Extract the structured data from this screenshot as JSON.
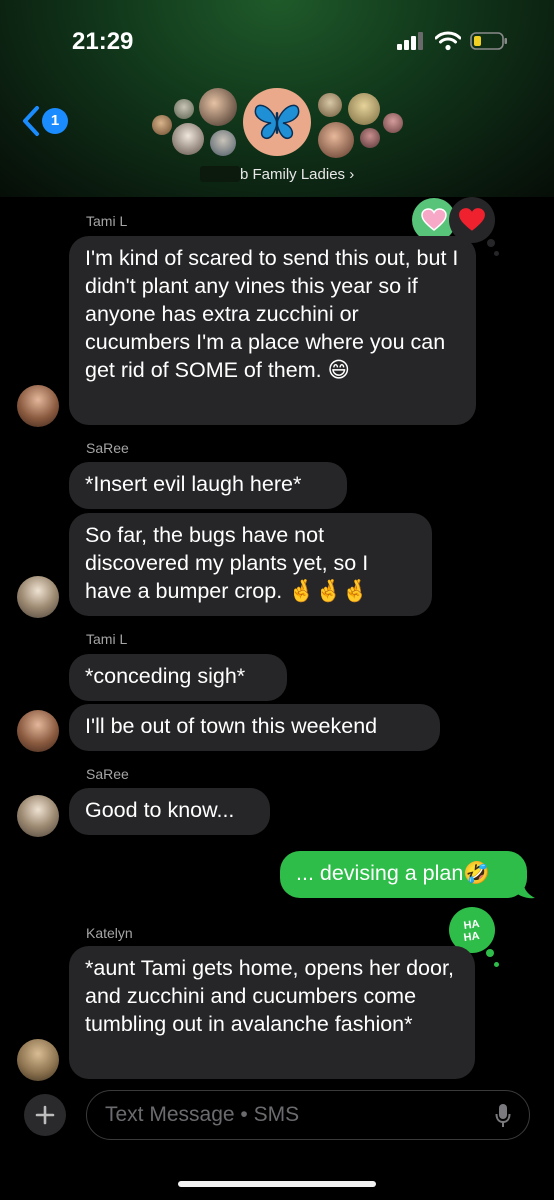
{
  "status_bar": {
    "time": "21:29"
  },
  "header": {
    "back_badge": "1",
    "group_name_suffix": "b Family Ladies ›"
  },
  "conversation": {
    "messages": [
      {
        "sender": "Tami L",
        "text": "I'm kind of scared to send this out, but I didn't plant any vines this year so if anyone has extra zucchini or cucumbers I'm a place where you can get rid of SOME of them. 😄",
        "tapbacks": [
          "heart",
          "heart"
        ]
      },
      {
        "sender": "SaRee",
        "text": "*Insert evil laugh here*"
      },
      {
        "sender": "",
        "text": "So far, the bugs have not discovered my plants yet, so I have a bumper crop. 🤞🤞🤞"
      },
      {
        "sender": "Tami L",
        "text": "*conceding sigh*"
      },
      {
        "sender": "",
        "text": "I'll be out of town this weekend"
      },
      {
        "sender": "SaRee",
        "text": "Good to know..."
      },
      {
        "sender": "me",
        "text": "... devising a plan🤣"
      },
      {
        "sender": "Katelyn",
        "text": "*aunt Tami gets home, opens her door, and zucchini and cucumbers come tumbling out in avalanche fashion*",
        "tapbacks": [
          "haha"
        ]
      }
    ]
  },
  "composer": {
    "placeholder": "Text Message • SMS"
  },
  "colors": {
    "incoming": "#262628",
    "outgoing": "#2fbd4a",
    "accent": "#1a8cff"
  }
}
